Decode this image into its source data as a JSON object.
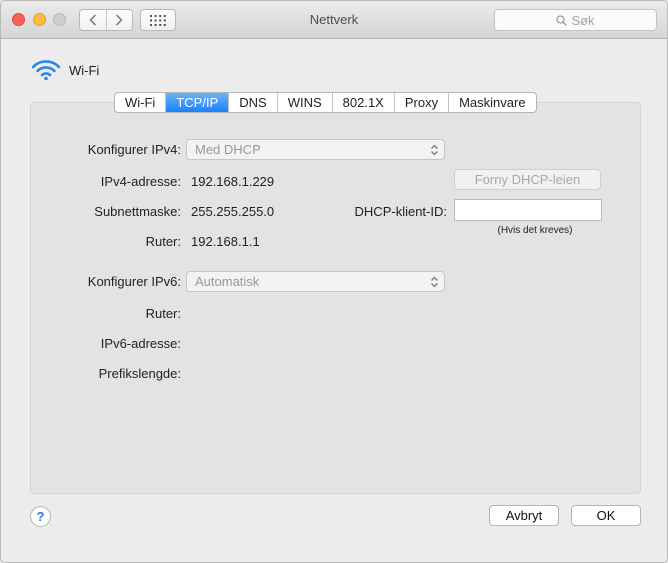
{
  "window": {
    "title": "Nettverk",
    "search_placeholder": "Søk",
    "controls": [
      "close",
      "minimize",
      "zoom"
    ],
    "nav": {
      "back_icon": "chevron-left-icon",
      "forward_icon": "chevron-right-icon",
      "grid_icon": "grid-icon"
    }
  },
  "service": {
    "name": "Wi-Fi",
    "icon": "wifi-icon",
    "accent": "#2e87e6"
  },
  "tabs": [
    {
      "label": "Wi-Fi",
      "active": false
    },
    {
      "label": "TCP/IP",
      "active": true
    },
    {
      "label": "DNS",
      "active": false
    },
    {
      "label": "WINS",
      "active": false
    },
    {
      "label": "802.1X",
      "active": false
    },
    {
      "label": "Proxy",
      "active": false
    },
    {
      "label": "Maskinvare",
      "active": false
    }
  ],
  "ipv4": {
    "configure_label": "Konfigurer IPv4:",
    "configure_value": "Med DHCP",
    "address_label": "IPv4-adresse:",
    "address_value": "192.168.1.229",
    "subnet_label": "Subnettmaske:",
    "subnet_value": "255.255.255.0",
    "router_label": "Ruter:",
    "router_value": "192.168.1.1",
    "renew_button": "Forny DHCP-leien",
    "client_id_label": "DHCP-klient-ID:",
    "client_id_value": "",
    "client_id_hint": "(Hvis det kreves)"
  },
  "ipv6": {
    "configure_label": "Konfigurer IPv6:",
    "configure_value": "Automatisk",
    "router_label": "Ruter:",
    "router_value": "",
    "address_label": "IPv6-adresse:",
    "address_value": "",
    "prefix_label": "Prefikslengde:",
    "prefix_value": ""
  },
  "footer": {
    "help_label": "?",
    "cancel_label": "Avbryt",
    "ok_label": "OK"
  }
}
